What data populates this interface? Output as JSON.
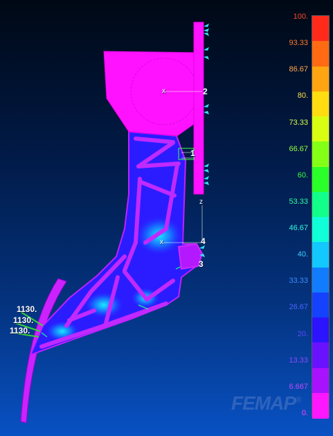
{
  "viewer": {
    "watermark": "FEMAP",
    "watermark_mark": "®"
  },
  "legend": {
    "labels": [
      "100.",
      "93.33",
      "86.67",
      "80.",
      "73.33",
      "66.67",
      "60.",
      "53.33",
      "46.67",
      "40.",
      "33.33",
      "26.67",
      "20.",
      "13.33",
      "6.667",
      "0."
    ],
    "colors": [
      "#ff2a1a",
      "#ff6a12",
      "#ffa512",
      "#ffdd10",
      "#d8ff12",
      "#84ff16",
      "#2aff2a",
      "#12ff8a",
      "#10ffd8",
      "#12c8ff",
      "#127cff",
      "#1442ff",
      "#2c14ff",
      "#6812ff",
      "#a812ff",
      "#ff18ff"
    ],
    "label_colors": [
      "#ff4a2a",
      "#ff7a2a",
      "#ffa84a",
      "#ffe04a",
      "#d8ff4a",
      "#90ff40",
      "#3cff3c",
      "#30ff9a",
      "#30ffe0",
      "#3ad0ff",
      "#3a8aff",
      "#4a66ff",
      "#5a4aff",
      "#8a4aff",
      "#c04aff",
      "#ff44ff"
    ]
  },
  "annotations": {
    "node_1": "1",
    "node_2": "2",
    "node_3": "3",
    "node_4": "4",
    "axis_z": "z",
    "axis_x_top": "x",
    "axis_x_mid": "x",
    "load_1": "1130.",
    "load_2": "1130.",
    "load_3": "1130."
  }
}
